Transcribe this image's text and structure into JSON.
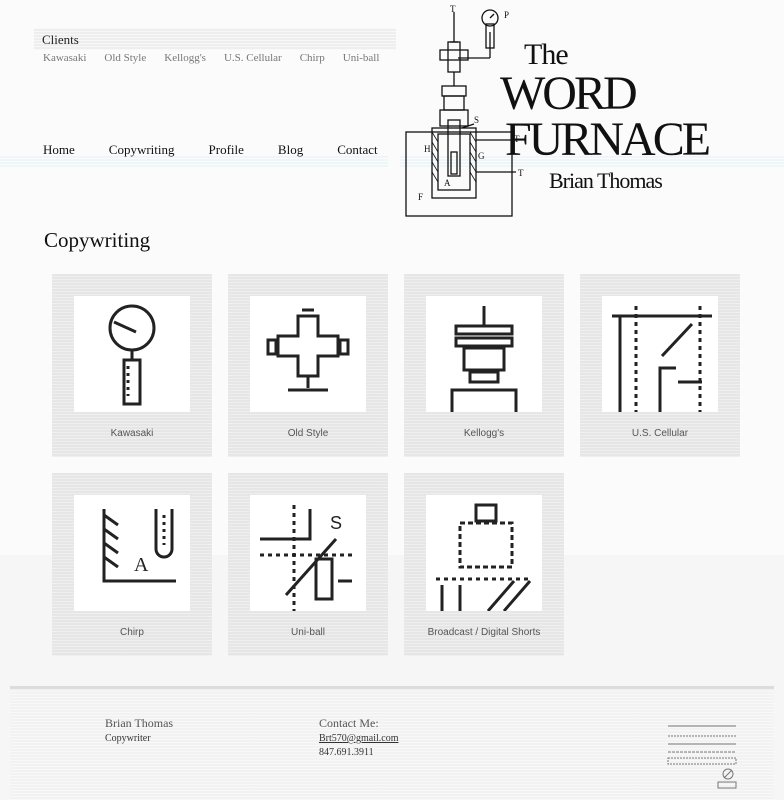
{
  "clients": {
    "title": "Clients",
    "links": [
      "Kawasaki",
      "Old Style",
      "Kellogg's",
      "U.S. Cellular",
      "Chirp",
      "Uni-ball"
    ]
  },
  "nav": {
    "items": [
      "Home",
      "Copywriting",
      "Profile",
      "Blog",
      "Contact"
    ]
  },
  "logo": {
    "the": "The",
    "word": "WORD",
    "furnace": "FURNACE",
    "name": "Brian Thomas",
    "labels": [
      "T",
      "P",
      "S",
      "T",
      "H",
      "G",
      "T",
      "A",
      "F"
    ]
  },
  "page": {
    "heading": "Copywriting"
  },
  "portfolio": {
    "items": [
      {
        "label": "Kawasaki",
        "icon": "gauge-icon"
      },
      {
        "label": "Old Style",
        "icon": "valve-cross-icon"
      },
      {
        "label": "Kellogg's",
        "icon": "coupling-icon"
      },
      {
        "label": "U.S. Cellular",
        "icon": "vessel-wall-icon"
      },
      {
        "label": "Chirp",
        "icon": "tube-a-icon"
      },
      {
        "label": "Uni-ball",
        "icon": "section-s-icon"
      },
      {
        "label": "Broadcast / Digital Shorts",
        "icon": "reactor-base-icon"
      }
    ]
  },
  "footer": {
    "name": "Brian Thomas",
    "role": "Copywriter",
    "contact_label": "Contact Me:",
    "email": "Brt570@gmail.com",
    "phone": "847.691.3911"
  }
}
